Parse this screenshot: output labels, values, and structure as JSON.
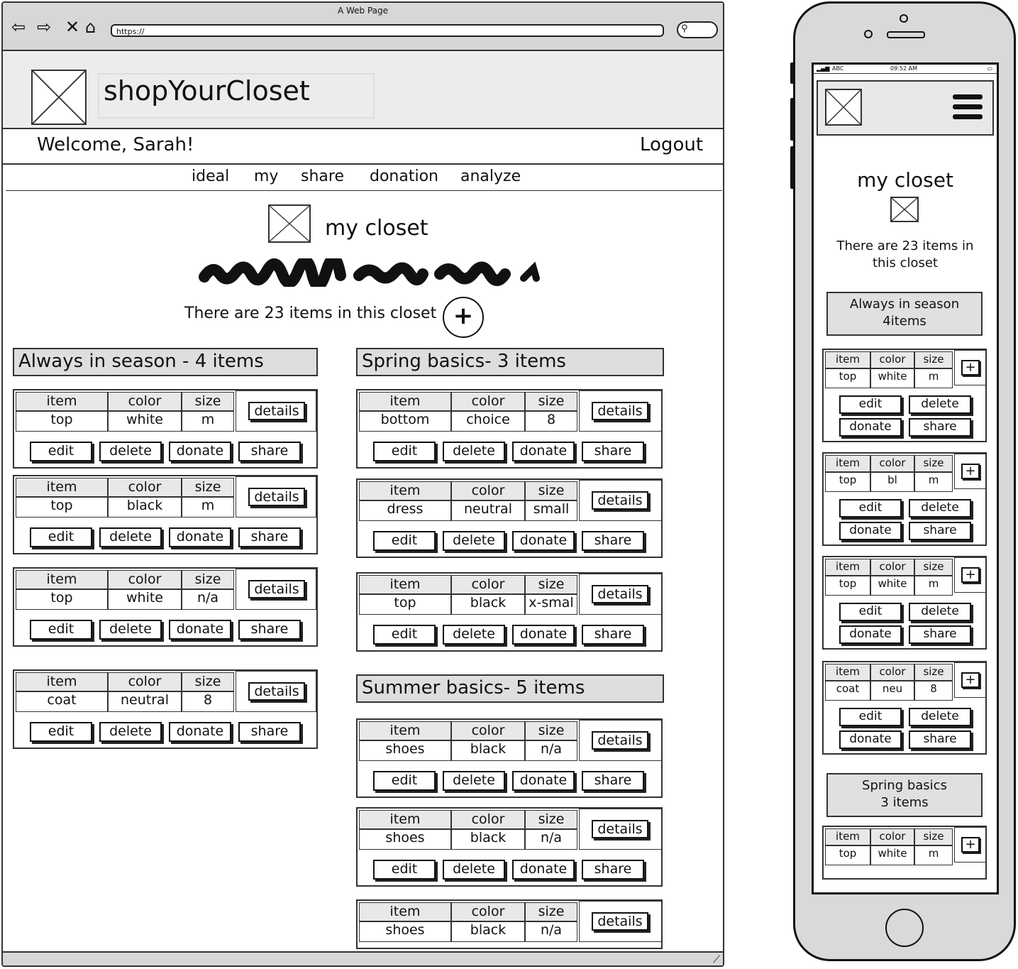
{
  "window": {
    "title": "A Web Page",
    "url": "https://"
  },
  "header": {
    "brand": "shopYourCloset",
    "welcome": "Welcome, Sarah!",
    "logout": "Logout"
  },
  "nav": [
    "ideal",
    "my",
    "share",
    "donation",
    "analyze"
  ],
  "main": {
    "title": "my closet",
    "count_text": "There are 23 items in this closet",
    "add_label": "+"
  },
  "labels": {
    "item": "item",
    "color": "color",
    "size": "size",
    "details": "details",
    "edit": "edit",
    "delete": "delete",
    "donate": "donate",
    "share": "share"
  },
  "sections": [
    {
      "heading": "Always in season - 4 items",
      "items": [
        {
          "item": "top",
          "color": "white",
          "size": "m"
        },
        {
          "item": "top",
          "color": "black",
          "size": "m"
        },
        {
          "item": "top",
          "color": "white",
          "size": "n/a"
        },
        {
          "item": "coat",
          "color": "neutral",
          "size": "8"
        }
      ]
    },
    {
      "heading": "Spring basics- 3 items",
      "items": [
        {
          "item": "bottom",
          "color": "choice",
          "size": "8"
        },
        {
          "item": "dress",
          "color": "neutral",
          "size": "small"
        },
        {
          "item": "top",
          "color": "black",
          "size": "x-smal"
        }
      ]
    },
    {
      "heading": "Summer basics- 5 items",
      "items": [
        {
          "item": "shoes",
          "color": "black",
          "size": "n/a"
        },
        {
          "item": "shoes",
          "color": "black",
          "size": "n/a"
        },
        {
          "item": "shoes",
          "color": "black",
          "size": "n/a"
        }
      ]
    }
  ],
  "mobile": {
    "status_carrier": "ABC",
    "status_time": "09:52 AM",
    "title": "my closet",
    "count_line1": "There are 23 items in",
    "count_line2": "this closet",
    "sections": [
      {
        "line1": "Always in season",
        "line2": "4items",
        "items": [
          {
            "item": "top",
            "color": "white",
            "size": "m"
          },
          {
            "item": "top",
            "color": "bl",
            "size": "m"
          },
          {
            "item": "top",
            "color": "white",
            "size": "m"
          },
          {
            "item": "coat",
            "color": "neu",
            "size": "8"
          }
        ]
      },
      {
        "line1": "Spring basics",
        "line2": "3 items",
        "items": [
          {
            "item": "top",
            "color": "white",
            "size": "m"
          }
        ]
      }
    ],
    "plus": "+"
  },
  "icons": {
    "back": "arrow-left-icon",
    "forward": "arrow-right-icon",
    "stop": "close-icon",
    "home": "home-icon",
    "search": "search-icon",
    "menu": "hamburger-menu-icon"
  }
}
